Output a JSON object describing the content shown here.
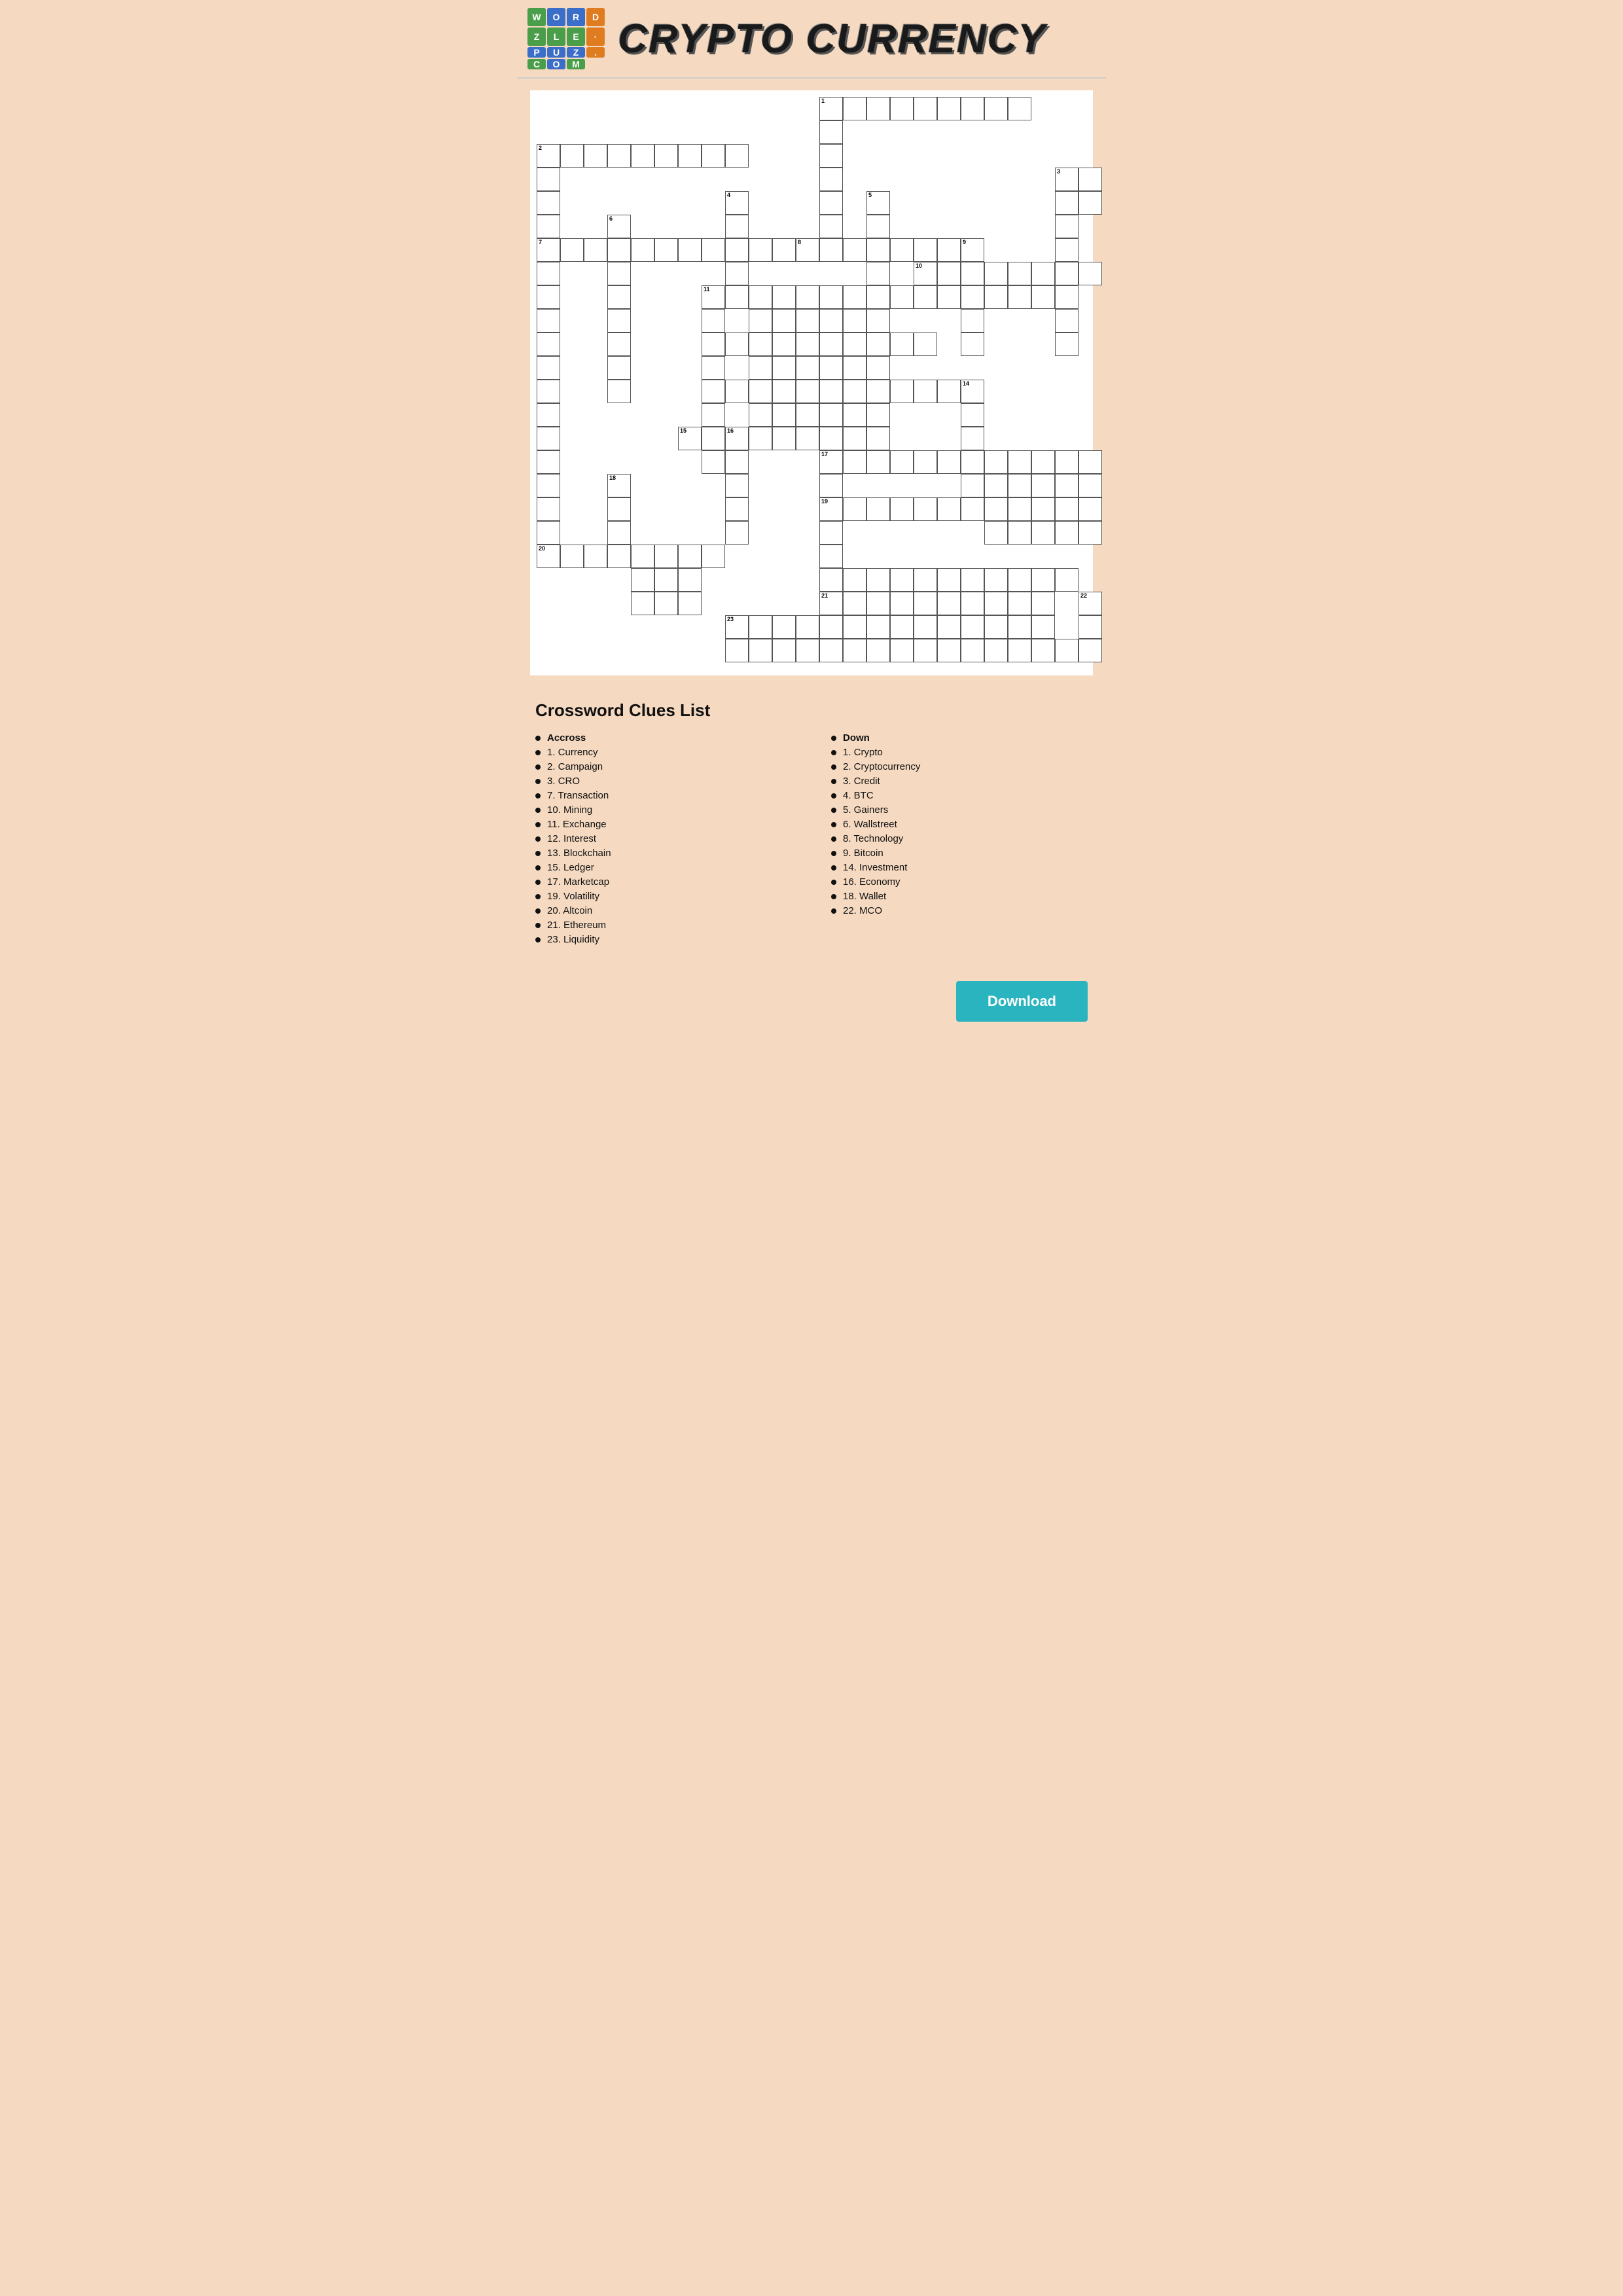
{
  "header": {
    "title": "CRYPTO CURRENCY",
    "logo": {
      "cells": [
        {
          "letter": "W",
          "color": "logo-green"
        },
        {
          "letter": "O",
          "color": "logo-blue"
        },
        {
          "letter": "R",
          "color": "logo-blue"
        },
        {
          "letter": "D",
          "color": "logo-orange"
        },
        {
          "letter": "Z",
          "color": "logo-green"
        },
        {
          "letter": "L",
          "color": "logo-green"
        },
        {
          "letter": "E",
          "color": "logo-green"
        },
        {
          "letter": "·",
          "color": "logo-orange"
        },
        {
          "letter": "P",
          "color": "logo-blue"
        },
        {
          "letter": "U",
          "color": "logo-blue"
        },
        {
          "letter": "Z",
          "color": "logo-blue"
        },
        {
          "letter": "C",
          "color": "logo-green"
        },
        {
          "letter": "O",
          "color": "logo-blue"
        },
        {
          "letter": "M",
          "color": "logo-green"
        }
      ]
    }
  },
  "clues": {
    "title": "Crossword Clues List",
    "across": {
      "heading": "Accross",
      "items": [
        "1. Currency",
        "2. Campaign",
        "3. CRO",
        "7. Transaction",
        "10. Mining",
        "11. Exchange",
        "12. Interest",
        "13. Blockchain",
        "15. Ledger",
        "17. Marketcap",
        "19. Volatility",
        "20. Altcoin",
        "21. Ethereum",
        "23. Liquidity"
      ]
    },
    "down": {
      "heading": "Down",
      "items": [
        "1. Crypto",
        "2. Cryptocurrency",
        "3. Credit",
        "4. BTC",
        "5. Gainers",
        "6. Wallstreet",
        "8. Technology",
        "9. Bitcoin",
        "14. Investment",
        "16. Economy",
        "18. Wallet",
        "22. MCO"
      ]
    }
  },
  "download_button": "Download"
}
